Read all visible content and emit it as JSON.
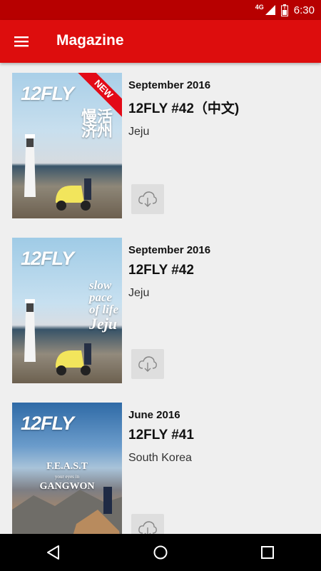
{
  "status_bar": {
    "network": "4G",
    "time": "6:30",
    "icons": [
      "signal-icon",
      "battery-icon"
    ]
  },
  "app_bar": {
    "title": "Magazine",
    "menu_icon": "hamburger-menu-icon"
  },
  "theme": {
    "primary": "#dd0d0d",
    "status_bar": "#b70000",
    "background": "#efefef"
  },
  "magazines": [
    {
      "date": "September 2016",
      "title": "12FLY #42（中文)",
      "location": "Jeju",
      "badge": "NEW",
      "cover_logo": "12FLY",
      "cover_text": "慢活济州",
      "download_icon": "cloud-download-icon"
    },
    {
      "date": "September 2016",
      "title": "12FLY #42",
      "location": "Jeju",
      "cover_logo": "12FLY",
      "cover_text_1": "slow",
      "cover_text_2": "pace",
      "cover_text_3": "of life",
      "cover_text_4": "Jeju",
      "download_icon": "cloud-download-icon"
    },
    {
      "date": "June 2016",
      "title": "12FLY #41",
      "location": "South Korea",
      "cover_logo": "12FLY",
      "cover_text_1": "F.E.A.S.T",
      "cover_text_2": "your eyes in",
      "cover_text_3": "GANGWON",
      "download_icon": "cloud-download-icon"
    }
  ],
  "nav_bar": {
    "icons": [
      "back-icon",
      "home-icon",
      "recents-icon"
    ]
  }
}
